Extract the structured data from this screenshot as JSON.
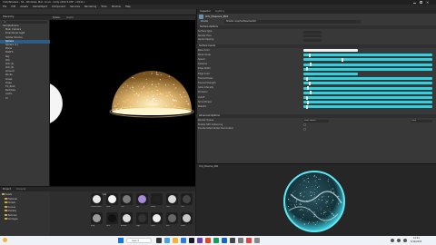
{
  "window": {
    "title": "UnityShaders - SS - Windows, Mac, Linux - Unity 2022.3.0f1* <DX11>"
  },
  "menu": [
    "File",
    "Edit",
    "Assets",
    "GameObject",
    "Component",
    "Services",
    "Rendering",
    "Tools",
    "Window",
    "Help"
  ],
  "toolbar": {
    "play_icon": "play-icon",
    "pause_icon": "pause-icon",
    "step_icon": "step-icon"
  },
  "hierarchy": {
    "title": "Hierarchy",
    "search_placeholder": "All",
    "items": [
      "SampleScene",
      "Main Camera",
      "Directional Light",
      "Global Volume",
      "Sphere",
      "Sphere (1)",
      "Plane",
      "PostFX",
      "Sky",
      "Orb",
      "Orb (1)",
      "Orb (2)",
      "Ground",
      "Rocks",
      "Grass",
      "Trees",
      "FX_Root",
      "Particles",
      "Audio",
      "UI"
    ]
  },
  "scene_tabs": [
    "Scene",
    "Game"
  ],
  "project": {
    "tabs": [
      "Project",
      "Console"
    ],
    "breadcrumb": "Assets > Materials",
    "folders": [
      "Assets",
      "Materials",
      "Models",
      "Scenes",
      "Shaders",
      "Textures",
      "Packages"
    ],
    "assets": [
      "DissolveMat",
      "Glow",
      "Orb",
      "Sky",
      "Noise",
      "Dots",
      "Cell",
      "Ring",
      "Dark",
      "Bubble",
      "Edge",
      "Stars",
      "Mist",
      "Sand"
    ]
  },
  "inspector": {
    "tabs": [
      "Inspector",
      "Lighting"
    ],
    "material_name": "Orb_Dissolve_Mat",
    "shader_label": "Shader",
    "shader_value": "Shader Graphs/DissolveOrb",
    "section_surface": "Surface Options",
    "surface_rows": [
      "Surface Type",
      "Render Face",
      "Alpha Clipping"
    ],
    "section_inputs": "Surface Inputs",
    "input_rows": [
      "Base Color",
      "Noise Scale",
      "Speed",
      "Dissolve",
      "Edge Width",
      "Edge Color",
      "Fresnel Power",
      "Fresnel Strength",
      "Glow Intensity",
      "Emission",
      "Cutoff",
      "Smoothness",
      "Metallic"
    ],
    "section_advanced": "Advanced Options",
    "advanced_rows": [
      "Render Queue",
      "Enable GPU Instancing",
      "Double Sided Global Illumination"
    ],
    "render_queue_value": "From Shader",
    "render_queue_number": "2000"
  },
  "preview": {
    "label": "Orb_Dissolve_Mat"
  },
  "taskbar": {
    "search_placeholder": "Search",
    "time": "12:41",
    "date": "5/14/2023"
  },
  "colors": {
    "accent": "#2fd2e0",
    "selection": "#2c5d87",
    "orb_glow": "#f4e2a0"
  }
}
